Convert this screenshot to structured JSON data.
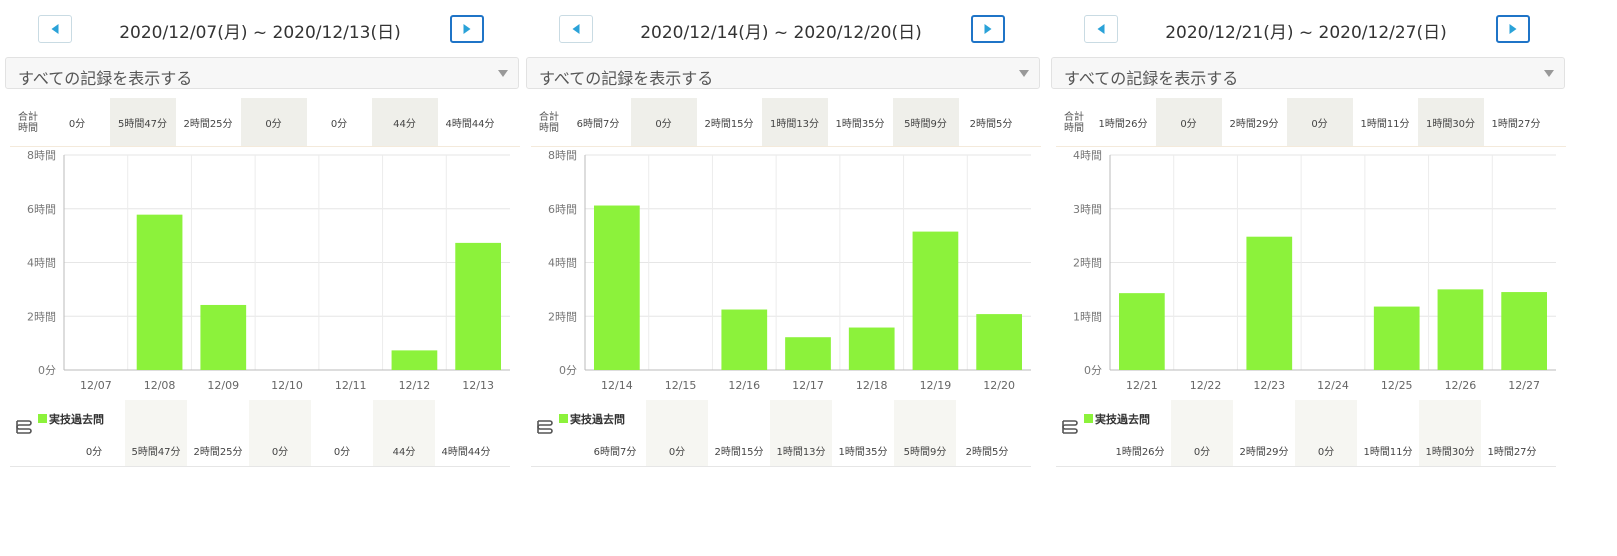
{
  "filter_label": "すべての記録を表示する",
  "totals_label": [
    "合計",
    "時間"
  ],
  "legend_name": "実技過去問",
  "colors": {
    "bar": "#8cf23b",
    "accent": "#2aa2d8",
    "next_border": "#1f74c7"
  },
  "weeks": [
    {
      "title": "2020/12/07(月) ~ 2020/12/13(日)",
      "totals": [
        "0分",
        "5時間47分",
        "2時間25分",
        "0分",
        "0分",
        "44分",
        "4時間44分"
      ],
      "legend_values": [
        "0分",
        "5時間47分",
        "2時間25分",
        "0分",
        "0分",
        "44分",
        "4時間44分"
      ],
      "chart_data": {
        "type": "bar",
        "categories": [
          "12/07",
          "12/08",
          "12/09",
          "12/10",
          "12/11",
          "12/12",
          "12/13"
        ],
        "values": [
          0,
          5.78,
          2.42,
          0,
          0,
          0.73,
          4.73
        ],
        "yticks": [
          "0分",
          "2時間",
          "4時間",
          "6時間",
          "8時間"
        ],
        "ylim": [
          0,
          8
        ]
      }
    },
    {
      "title": "2020/12/14(月) ~ 2020/12/20(日)",
      "totals": [
        "6時間7分",
        "0分",
        "2時間15分",
        "1時間13分",
        "1時間35分",
        "5時間9分",
        "2時間5分"
      ],
      "legend_values": [
        "6時間7分",
        "0分",
        "2時間15分",
        "1時間13分",
        "1時間35分",
        "5時間9分",
        "2時間5分"
      ],
      "chart_data": {
        "type": "bar",
        "categories": [
          "12/14",
          "12/15",
          "12/16",
          "12/17",
          "12/18",
          "12/19",
          "12/20"
        ],
        "values": [
          6.12,
          0,
          2.25,
          1.22,
          1.58,
          5.15,
          2.08
        ],
        "yticks": [
          "0分",
          "2時間",
          "4時間",
          "6時間",
          "8時間"
        ],
        "ylim": [
          0,
          8
        ]
      }
    },
    {
      "title": "2020/12/21(月) ~ 2020/12/27(日)",
      "totals": [
        "1時間26分",
        "0分",
        "2時間29分",
        "0分",
        "1時間11分",
        "1時間30分",
        "1時間27分"
      ],
      "legend_values": [
        "1時間26分",
        "0分",
        "2時間29分",
        "0分",
        "1時間11分",
        "1時間30分",
        "1時間27分"
      ],
      "chart_data": {
        "type": "bar",
        "categories": [
          "12/21",
          "12/22",
          "12/23",
          "12/24",
          "12/25",
          "12/26",
          "12/27"
        ],
        "values": [
          1.43,
          0,
          2.48,
          0,
          1.18,
          1.5,
          1.45
        ],
        "yticks": [
          "0分",
          "1時間",
          "2時間",
          "3時間",
          "4時間"
        ],
        "ylim": [
          0,
          4
        ]
      }
    }
  ]
}
